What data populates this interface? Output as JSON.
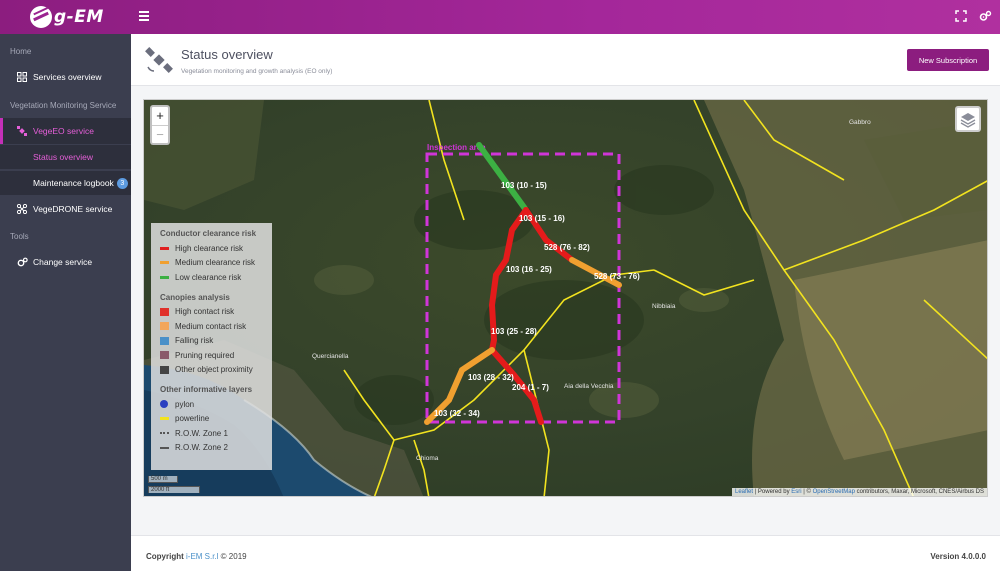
{
  "app": {
    "logo_text": "g-EM"
  },
  "sidebar": {
    "home_section": "Home",
    "services_overview": "Services overview",
    "vms_section": "Vegetation Monitoring Service",
    "vegeeo": "VegeEO service",
    "status_overview": "Status overview",
    "maintenance_logbook": "Maintenance logbook",
    "maintenance_badge": "3",
    "vegedrone": "VegeDRONE service",
    "tools_section": "Tools",
    "change_service": "Change service"
  },
  "header": {
    "title": "Status overview",
    "subtitle": "Vegetation monitoring and growth analysis (EO only)",
    "new_subscription": "New Subscription"
  },
  "map": {
    "zoom_in": "+",
    "zoom_out": "−",
    "inspection_area_label": "Inspection area",
    "segments": [
      {
        "label": "103 (10 - 15)",
        "risk": "low"
      },
      {
        "label": "103 (15 - 16)",
        "risk": "high"
      },
      {
        "label": "528 (76 - 82)",
        "risk": "high"
      },
      {
        "label": "528 (73 - 76)",
        "risk": "medium"
      },
      {
        "label": "103 (16 - 25)",
        "risk": "high"
      },
      {
        "label": "103 (25 - 28)",
        "risk": "high"
      },
      {
        "label": "103 (28 - 32)",
        "risk": "medium"
      },
      {
        "label": "204 (1 - 7)",
        "risk": "high"
      },
      {
        "label": "103 (32 - 34)",
        "risk": "medium"
      }
    ],
    "places": [
      "Gabbro",
      "Nibbiaia",
      "Quercianella",
      "Aia della Vecchia",
      "Chioma"
    ],
    "scale_metric": "500 m",
    "scale_imperial": "2000 ft",
    "attribution": {
      "leaflet": "Leaflet",
      "powered": " | Powered by ",
      "esri": "Esri",
      "sep": " | © ",
      "osm": "OpenStreetMap",
      "rest": " contributors, Maxar, Microsoft, CNES/Airbus DS"
    }
  },
  "legend": {
    "conductor_title": "Conductor clearance risk",
    "conductor_items": [
      {
        "label": "High clearance risk",
        "color": "#e02020"
      },
      {
        "label": "Medium clearance risk",
        "color": "#f0a030"
      },
      {
        "label": "Low clearance risk",
        "color": "#3cb043"
      }
    ],
    "canopies_title": "Canopies analysis",
    "canopies_items": [
      {
        "label": "High contact risk",
        "color": "#e0312a"
      },
      {
        "label": "Medium contact risk",
        "color": "#f2a65a"
      },
      {
        "label": "Falling risk",
        "color": "#4a90c8"
      },
      {
        "label": "Pruning required",
        "color": "#8a5a6a"
      },
      {
        "label": "Other object proximity",
        "color": "#444444"
      }
    ],
    "other_title": "Other informative layers",
    "pylon": "pylon",
    "powerline": "powerline",
    "row1": "R.O.W. Zone 1",
    "row2": "R.O.W. Zone 2"
  },
  "footer": {
    "copyright_prefix": "Copyright ",
    "brand": "i-EM S.r.l",
    "copyright_suffix": " © 2019",
    "version": "Version 4.0.0.0"
  },
  "colors": {
    "accent": "#8c1d7f",
    "sidebar": "#3b3e4f",
    "high": "#e41b1b",
    "medium": "#f0a030",
    "low": "#3cb043",
    "area": "#c530d0"
  }
}
